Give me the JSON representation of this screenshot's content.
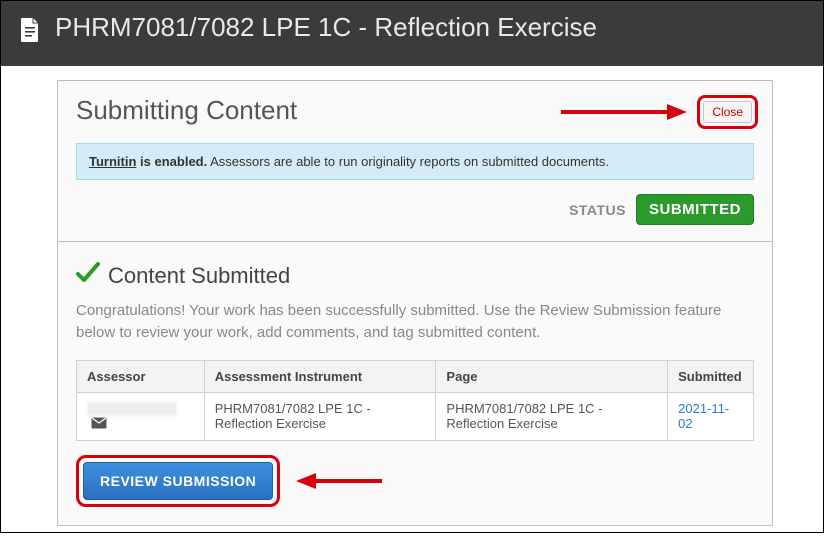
{
  "header": {
    "title": "PHRM7081/7082 LPE 1C - Reflection Exercise"
  },
  "panel": {
    "heading": "Submitting Content",
    "close_label": "Close",
    "info": {
      "turnitin": "Turnitin",
      "enabled": " is enabled.",
      "rest": " Assessors are able to run originality reports on submitted documents."
    },
    "status_label": "STATUS",
    "status_value": "SUBMITTED"
  },
  "submitted": {
    "heading": "Content Submitted",
    "congrats": "Congratulations! Your work has been successfully submitted. Use the Review Submission feature below to review your work, add comments, and tag submitted content.",
    "columns": {
      "assessor": "Assessor",
      "instrument": "Assessment Instrument",
      "page": "Page",
      "submitted": "Submitted"
    },
    "row": {
      "instrument": "PHRM7081/7082 LPE 1C - Reflection Exercise",
      "page": "PHRM7081/7082 LPE 1C - Reflection Exercise",
      "submitted": "2021-11-02"
    },
    "review_label": "REVIEW SUBMISSION"
  }
}
